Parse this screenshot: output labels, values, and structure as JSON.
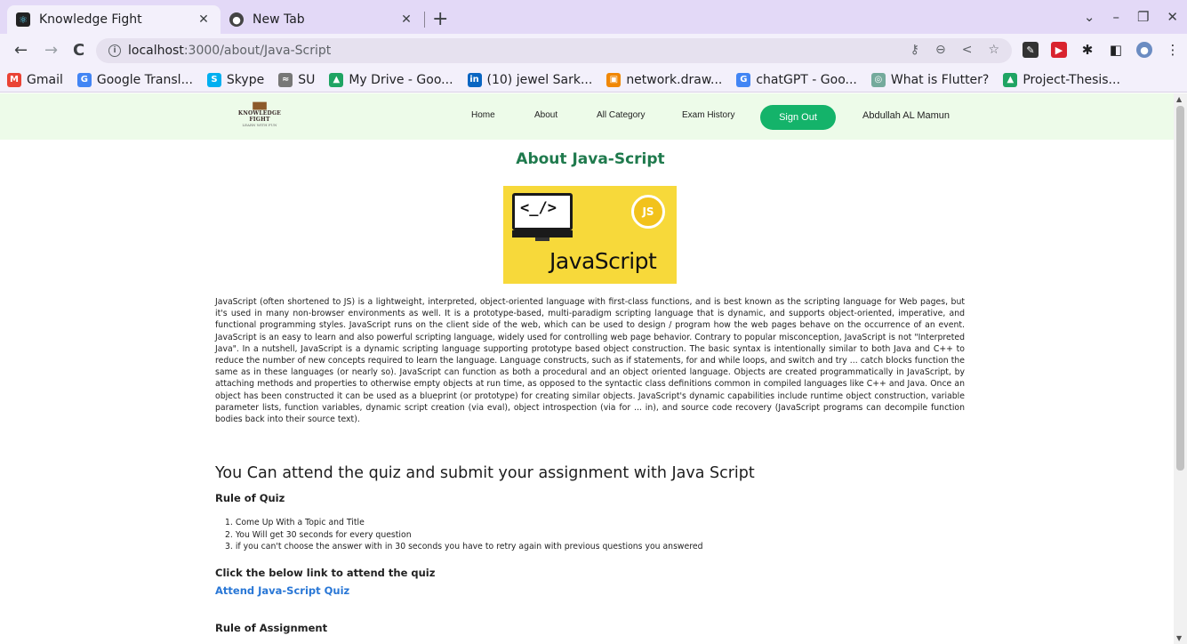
{
  "browser": {
    "tabs": [
      {
        "title": "Knowledge Fight",
        "active": true,
        "favicon": "react-icon"
      },
      {
        "title": "New Tab",
        "active": false,
        "favicon": "chrome-icon"
      }
    ],
    "new_tab_label": "+",
    "url_host": "localhost",
    "url_path": ":3000/about/Java-Script",
    "bookmarks": [
      {
        "label": "Gmail",
        "icon": "gmail-icon",
        "color": "#ea4335",
        "glyph": "M"
      },
      {
        "label": "Google Transl...",
        "icon": "translate-icon",
        "color": "#4285f4",
        "glyph": "G"
      },
      {
        "label": "Skype",
        "icon": "skype-icon",
        "color": "#00aff0",
        "glyph": "S"
      },
      {
        "label": "SU",
        "icon": "chart-icon",
        "color": "#777777",
        "glyph": "≈"
      },
      {
        "label": "My Drive - Goo...",
        "icon": "drive-icon",
        "color": "#1fa463",
        "glyph": "▲"
      },
      {
        "label": "(10) jewel Sark...",
        "icon": "linkedin-icon",
        "color": "#0a66c2",
        "glyph": "in"
      },
      {
        "label": "network.draw...",
        "icon": "drawio-icon",
        "color": "#f08705",
        "glyph": "▣"
      },
      {
        "label": "chatGPT - Goo...",
        "icon": "google-icon",
        "color": "#4285f4",
        "glyph": "G"
      },
      {
        "label": "What is Flutter?",
        "icon": "openai-icon",
        "color": "#74aa9c",
        "glyph": "◎"
      },
      {
        "label": "Project-Thesis...",
        "icon": "drive-icon",
        "color": "#1fa463",
        "glyph": "▲"
      }
    ]
  },
  "site": {
    "logo": {
      "line1": "KNOWLEDGE",
      "line2": "FIGHT",
      "line3": "LEARN WITH FUN"
    },
    "nav": {
      "home": "Home",
      "about": "About",
      "all_category": "All Category",
      "exam_history": "Exam History"
    },
    "sign_out": "Sign Out",
    "user_name": "Abdullah AL Mamun",
    "colors": {
      "nav_bg": "#edfbe9",
      "accent": "#14b36a",
      "title": "#1f7a4d",
      "link": "#2977d6"
    }
  },
  "main": {
    "title": "About Java-Script",
    "image": {
      "code_glyph": "<_/>",
      "badge": "JS",
      "word": "JavaScript"
    },
    "description": "JavaScript (often shortened to JS) is a lightweight, interpreted, object-oriented language with first-class functions, and is best known as the scripting language for Web pages, but it's used in many non-browser environments as well. It is a prototype-based, multi-paradigm scripting language that is dynamic, and supports object-oriented, imperative, and functional programming styles. JavaScript runs on the client side of the web, which can be used to design / program how the web pages behave on the occurrence of an event. JavaScript is an easy to learn and also powerful scripting language, widely used for controlling web page behavior. Contrary to popular misconception, JavaScript is not \"Interpreted Java\". In a nutshell, JavaScript is a dynamic scripting language supporting prototype based object construction. The basic syntax is intentionally similar to both Java and C++ to reduce the number of new concepts required to learn the language. Language constructs, such as if statements, for and while loops, and switch and try ... catch blocks function the same as in these languages (or nearly so). JavaScript can function as both a procedural and an object oriented language. Objects are created programmatically in JavaScript, by attaching methods and properties to otherwise empty objects at run time, as opposed to the syntactic class definitions common in compiled languages like C++ and Java. Once an object has been constructed it can be used as a blueprint (or prototype) for creating similar objects. JavaScript's dynamic capabilities include runtime object construction, variable parameter lists, function variables, dynamic script creation (via eval), object introspection (via for ... in), and source code recovery (JavaScript programs can decompile function bodies back into their source text).",
    "section_title": "You Can attend the quiz and submit your assignment with Java Script",
    "rule_quiz_heading": "Rule of Quiz",
    "rules": [
      "1. Come Up With a Topic and Title",
      "2. You Will get 30 seconds for every question",
      "3. if you can't choose the answer with in 30 seconds you have to retry again with previous questions you answered"
    ],
    "click_heading": "Click the below link to attend the quiz",
    "quiz_link": "Attend Java-Script Quiz",
    "rule_assignment_heading": "Rule of Assignment"
  }
}
